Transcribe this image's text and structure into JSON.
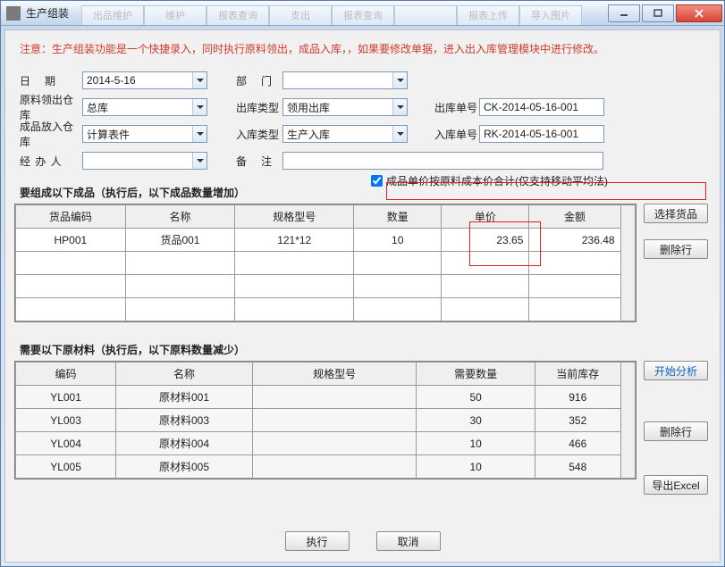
{
  "window": {
    "title": "生产组装",
    "ghost_tabs": [
      "出品维护",
      "维护",
      "报表查询",
      "支出",
      "报表查询",
      "",
      "报表上传",
      "导入图片"
    ]
  },
  "hint": "注意：生产组装功能是一个快捷录入，同时执行原料领出，成品入库，，如果要修改单据，进入出入库管理模块中进行修改。",
  "form": {
    "date_label": "日　期",
    "date": "2014-5-16",
    "dept_label": "部　门",
    "dept": "",
    "raw_wh_label": "原料领出仓库",
    "raw_wh": "总库",
    "out_type_label": "出库类型",
    "out_type": "领用出库",
    "out_no_label": "出库单号",
    "out_no": "CK-2014-05-16-001",
    "prod_wh_label": "成品放入仓库",
    "prod_wh": "计算表件",
    "in_type_label": "入库类型",
    "in_type": "生产入库",
    "in_no_label": "入库单号",
    "in_no": "RK-2014-05-16-001",
    "handler_label": "经 办 人",
    "handler": "",
    "remark_label": "备　注",
    "remark": ""
  },
  "products_caption": "要组成以下成品（执行后，以下成品数量增加）",
  "checkbox_label": "成品单价按原料成本价合计(仅支持移动平均法)",
  "products": {
    "headers": [
      "货品编码",
      "名称",
      "规格型号",
      "数量",
      "单价",
      "金额"
    ],
    "rows": [
      {
        "code": "HP001",
        "name": "货品001",
        "spec": "121*12",
        "qty": "10",
        "price": "23.65",
        "amount": "236.48"
      }
    ]
  },
  "materials_caption": "需要以下原材料（执行后，以下原料数量减少）",
  "materials": {
    "headers": [
      "编码",
      "名称",
      "规格型号",
      "需要数量",
      "当前库存"
    ],
    "rows": [
      {
        "code": "YL001",
        "name": "原材料001",
        "spec": "",
        "need": "50",
        "stock": "916"
      },
      {
        "code": "YL003",
        "name": "原材料003",
        "spec": "",
        "need": "30",
        "stock": "352"
      },
      {
        "code": "YL004",
        "name": "原材料004",
        "spec": "",
        "need": "10",
        "stock": "466"
      },
      {
        "code": "YL005",
        "name": "原材料005",
        "spec": "",
        "need": "10",
        "stock": "548"
      }
    ]
  },
  "buttons": {
    "select_product": "选择货品",
    "delete_row": "删除行",
    "analyze": "开始分析",
    "delete_row2": "删除行",
    "export_excel": "导出Excel",
    "execute": "执行",
    "cancel": "取消"
  }
}
